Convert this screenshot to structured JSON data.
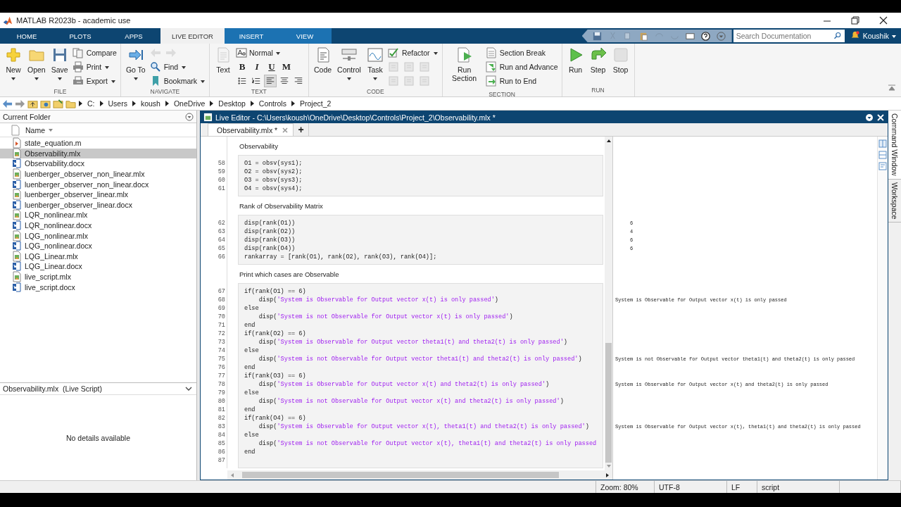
{
  "window": {
    "title": "MATLAB R2023b - academic use"
  },
  "ribbon": {
    "tabs": [
      {
        "label": "HOME",
        "selected": false,
        "contextual": false
      },
      {
        "label": "PLOTS",
        "selected": false,
        "contextual": false
      },
      {
        "label": "APPS",
        "selected": false,
        "contextual": false
      },
      {
        "label": "LIVE EDITOR",
        "selected": true,
        "contextual": true
      },
      {
        "label": "INSERT",
        "selected": false,
        "contextual": true
      },
      {
        "label": "VIEW",
        "selected": false,
        "contextual": true
      }
    ],
    "search": {
      "placeholder": "Search Documentation"
    },
    "user": "Koushik"
  },
  "toolstrip": {
    "groups": [
      {
        "label": "FILE",
        "large": [
          {
            "label": "New",
            "dropdown": true
          },
          {
            "label": "Open",
            "dropdown": true
          },
          {
            "label": "Save",
            "dropdown": true
          }
        ],
        "small": [
          {
            "kind": "command",
            "label": "Compare",
            "dropdown": false
          },
          {
            "kind": "command",
            "label": "Print",
            "dropdown": true
          },
          {
            "kind": "command",
            "label": "Export",
            "dropdown": true
          }
        ]
      },
      {
        "label": "NAVIGATE",
        "large": [
          {
            "label": "Go To",
            "dropdown": true
          }
        ],
        "small": [
          {
            "kind": "icon_row"
          },
          {
            "kind": "command",
            "label": "Find",
            "dropdown": true
          },
          {
            "kind": "command",
            "label": "Bookmark",
            "dropdown": true
          }
        ]
      },
      {
        "label": "TEXT",
        "large": [
          {
            "label": "Text",
            "dropdown": false
          }
        ],
        "format": {
          "style": "Normal",
          "marks": [
            "B",
            "I",
            "U",
            "M"
          ],
          "paragraph": [
            {
              "selected": false
            },
            {
              "selected": false
            },
            {
              "selected": true
            },
            {
              "selected": false
            },
            {
              "selected": false
            }
          ]
        }
      },
      {
        "label": "CODE",
        "large": [
          {
            "label": "Code",
            "dropdown": false
          },
          {
            "label": "Control",
            "dropdown": true
          },
          {
            "label": "Task",
            "dropdown": true
          }
        ],
        "small": [
          {
            "kind": "command",
            "label": "Refactor",
            "dropdown": true
          },
          {
            "kind": "icon_row"
          },
          {
            "kind": "icon_row"
          }
        ]
      },
      {
        "label": "SECTION",
        "large": [
          {
            "label": "Run Section",
            "dropdown": false
          }
        ],
        "small": [
          {
            "kind": "command",
            "label": "Section Break",
            "dropdown": false
          },
          {
            "kind": "command",
            "label": "Run and Advance",
            "dropdown": false
          },
          {
            "kind": "command",
            "label": "Run to End",
            "dropdown": false
          }
        ]
      },
      {
        "label": "RUN",
        "large": [
          {
            "label": "Run",
            "dropdown": false
          },
          {
            "label": "Step",
            "dropdown": false
          },
          {
            "label": "Stop",
            "dropdown": false
          }
        ]
      }
    ]
  },
  "address_bar": {
    "path": [
      "C:",
      "Users",
      "koush",
      "OneDrive",
      "Desktop",
      "Controls",
      "Project_2"
    ]
  },
  "current_folder": {
    "title": "Current Folder",
    "column": "Name",
    "files": [
      {
        "name": "state_equation.m",
        "kind": "m",
        "selected": false
      },
      {
        "name": "Observability.mlx",
        "kind": "mlx",
        "selected": true
      },
      {
        "name": "Observability.docx",
        "kind": "docx",
        "selected": false
      },
      {
        "name": "luenberger_observer_non_linear.mlx",
        "kind": "mlx",
        "selected": false
      },
      {
        "name": "luenberger_observer_non_linear.docx",
        "kind": "docx",
        "selected": false
      },
      {
        "name": "luenberger_observer_linear.mlx",
        "kind": "mlx",
        "selected": false
      },
      {
        "name": "luenberger_observer_linear.docx",
        "kind": "docx",
        "selected": false
      },
      {
        "name": "LQR_nonlinear.mlx",
        "kind": "mlx",
        "selected": false
      },
      {
        "name": "LQR_nonlinear.docx",
        "kind": "docx",
        "selected": false
      },
      {
        "name": "LQG_nonlinear.mlx",
        "kind": "mlx",
        "selected": false
      },
      {
        "name": "LQG_nonlinear.docx",
        "kind": "docx",
        "selected": false
      },
      {
        "name": "LQG_Linear.mlx",
        "kind": "mlx",
        "selected": false
      },
      {
        "name": "LQG_Linear.docx",
        "kind": "docx",
        "selected": false
      },
      {
        "name": "live_script.mlx",
        "kind": "mlx",
        "selected": false
      },
      {
        "name": "live_script.docx",
        "kind": "docx",
        "selected": false
      }
    ]
  },
  "details": {
    "title": "Observability.mlx  (Live Script)",
    "message": "No details available"
  },
  "editor": {
    "title": "Live Editor - C:\\Users\\koush\\OneDrive\\Desktop\\Controls\\Project_2\\Observability.mlx *",
    "tabs": [
      {
        "label": "Observability.mlx *",
        "selected": true
      }
    ],
    "new_tab": "+",
    "blocks": [
      {
        "kind": "text",
        "text": "Observability"
      },
      {
        "kind": "code",
        "lines": [
          {
            "number": "58",
            "code": "O1 = obsv(sys1);"
          },
          {
            "number": "59",
            "code": "O2 = obsv(sys2);"
          },
          {
            "number": "60",
            "code": "O3 = obsv(sys3);"
          },
          {
            "number": "61",
            "code": "O4 = obsv(sys4);"
          }
        ]
      },
      {
        "kind": "text",
        "text": "Rank of Observability Matrix"
      },
      {
        "kind": "code",
        "lines": [
          {
            "number": "62",
            "code": "disp(rank(O1))",
            "output": "     6"
          },
          {
            "number": "63",
            "code": "disp(rank(O2))",
            "output": "     4"
          },
          {
            "number": "64",
            "code": "disp(rank(O3))",
            "output": "     6"
          },
          {
            "number": "65",
            "code": "disp(rank(O4))",
            "output": "     6"
          },
          {
            "number": "66",
            "code": "rankarray = [rank(O1), rank(O2), rank(O3), rank(O4)];"
          }
        ]
      },
      {
        "kind": "text",
        "text": "Print which cases are Observable"
      },
      {
        "kind": "code",
        "lines": [
          {
            "number": "67",
            "code": "if(rank(O1) == 6)"
          },
          {
            "number": "68",
            "code": "    disp('System is Observable for Output vector x(t) is only passed')",
            "output": "System is Observable for Output vector x(t) is only passed"
          },
          {
            "number": "69",
            "code": "else"
          },
          {
            "number": "70",
            "code": "    disp('System is not Observable for Output vector x(t) is only passed')"
          },
          {
            "number": "71",
            "code": "end"
          },
          {
            "number": "72",
            "code": "if(rank(O2) == 6)"
          },
          {
            "number": "73",
            "code": "    disp('System is Observable for Output vector theta1(t) and theta2(t) is only passed')"
          },
          {
            "number": "74",
            "code": "else"
          },
          {
            "number": "75",
            "code": "    disp('System is not Observable for Output vector theta1(t) and theta2(t) is only passed')",
            "output": "System is not Observable for Output vector theta1(t) and theta2(t) is only passed"
          },
          {
            "number": "76",
            "code": "end"
          },
          {
            "number": "77",
            "code": "if(rank(O3) == 6)"
          },
          {
            "number": "78",
            "code": "    disp('System is Observable for Output vector x(t) and theta2(t) is only passed')",
            "output": "System is Observable for Output vector x(t) and theta2(t) is only passed"
          },
          {
            "number": "79",
            "code": "else"
          },
          {
            "number": "80",
            "code": "    disp('System is not Observable for Output vector x(t) and theta2(t) is only passed')"
          },
          {
            "number": "81",
            "code": "end"
          },
          {
            "number": "82",
            "code": "if(rank(O4) == 6)"
          },
          {
            "number": "83",
            "code": "    disp('System is Observable for Output vector x(t), theta1(t) and theta2(t) is only passed')",
            "output": "System is Observable for Output vector x(t), theta1(t) and theta2(t) is only passed"
          },
          {
            "number": "84",
            "code": "else"
          },
          {
            "number": "85",
            "code": "    disp('System is not Observable for Output vector x(t), theta1(t) and theta2(t) is only passed"
          },
          {
            "number": "86",
            "code": "end"
          },
          {
            "number": "87"
          }
        ]
      }
    ]
  },
  "side_tabs": [
    "Command Window",
    "Workspace"
  ],
  "status_bar": [
    "Zoom: 80%",
    "UTF-8",
    "LF",
    "script"
  ]
}
